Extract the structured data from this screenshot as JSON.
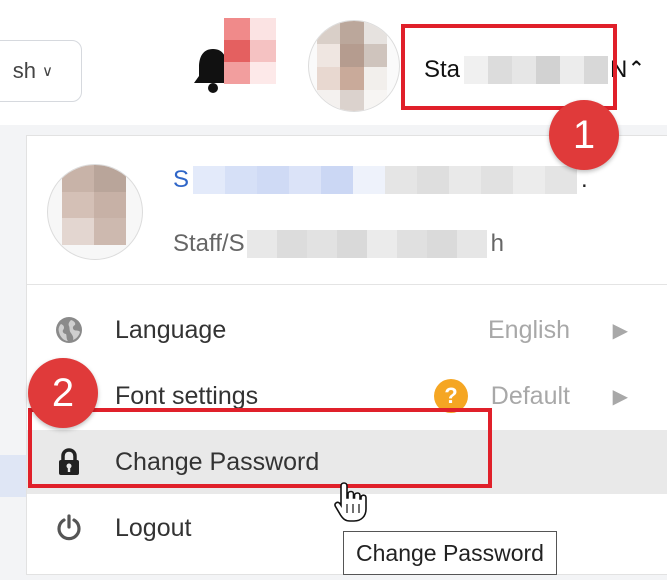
{
  "header": {
    "language_partial": "sh",
    "user_name_start": "Sta",
    "user_name_end": "N"
  },
  "annotations": {
    "step1": "1",
    "step2": "2"
  },
  "profile": {
    "name_start": "S",
    "name_end": ".",
    "role_start": "Staff/S",
    "role_end": "h"
  },
  "menu": {
    "items": [
      {
        "label": "Language",
        "value": "English",
        "icon": "globe-icon"
      },
      {
        "label": "Font settings",
        "value": "Default",
        "icon": "font-icon"
      },
      {
        "label": "Change Password",
        "value": "",
        "icon": "lock-icon"
      },
      {
        "label": "Logout",
        "value": "",
        "icon": "power-icon"
      }
    ],
    "help_glyph": "?"
  },
  "tooltip": {
    "text": "Change Password"
  },
  "colors": {
    "accent_red": "#e0202a",
    "badge_red": "#e03a3a",
    "link_blue": "#2f66c8",
    "help_orange": "#f5a623"
  }
}
